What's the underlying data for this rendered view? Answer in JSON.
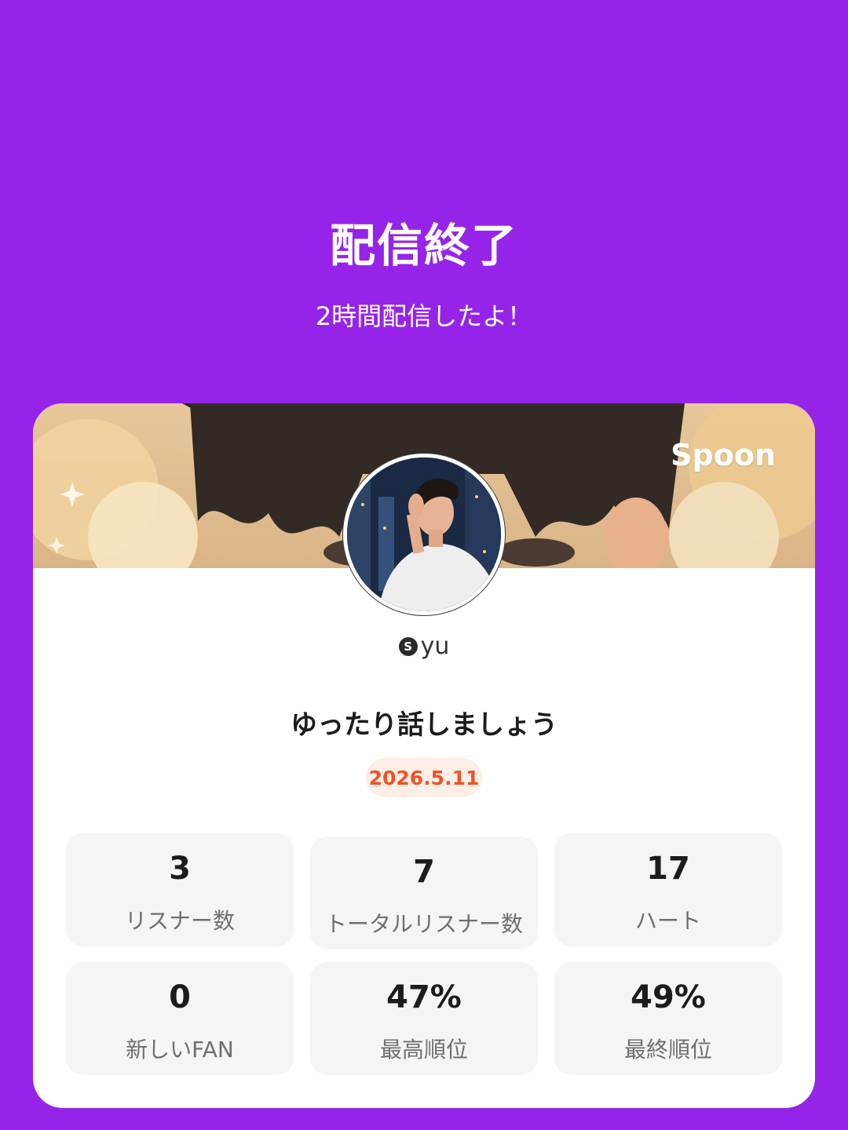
{
  "header": {
    "title": "配信終了",
    "subtitle": "2時間配信したよ！"
  },
  "card": {
    "brand": "Spoon",
    "user": {
      "badge": "S",
      "name": "yu"
    },
    "live_title": "ゆったり話しましょう",
    "date": "2026.5.11",
    "stats": [
      {
        "value": "3",
        "label": "リスナー数"
      },
      {
        "value": "7",
        "label": "トータルリスナー数"
      },
      {
        "value": "17",
        "label": "ハート"
      },
      {
        "value": "0",
        "label": "新しいFAN"
      },
      {
        "value": "47%",
        "label": "最高順位"
      },
      {
        "value": "49%",
        "label": "最終順位"
      }
    ]
  },
  "colors": {
    "background": "#9524e8",
    "date_text": "#ef5323",
    "date_bg": "#fdeee8",
    "stat_bg": "#f5f5f5"
  }
}
